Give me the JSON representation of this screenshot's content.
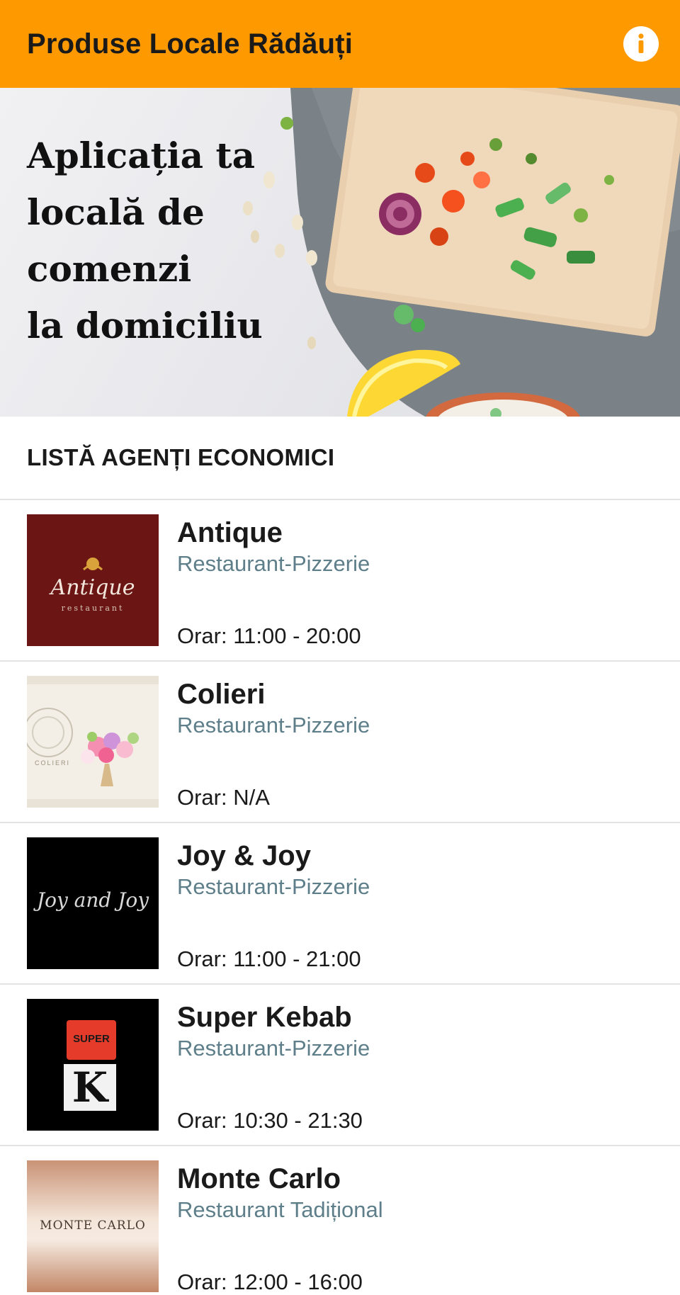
{
  "appbar": {
    "title": "Produse Locale Rădăuți",
    "info_icon": "info-icon",
    "background_color": "#ff9900"
  },
  "hero": {
    "lines": [
      "Aplicația ta",
      "locală de",
      "comenzi",
      "la domiciliu"
    ]
  },
  "section": {
    "title": "LISTĂ AGENȚI ECONOMICI"
  },
  "businesses": [
    {
      "name": "Antique",
      "category": "Restaurant-Pizzerie",
      "hours": "Orar: 11:00 - 20:00",
      "logo_text": "Antique",
      "logo_subtext": "restaurant"
    },
    {
      "name": "Colieri",
      "category": "Restaurant-Pizzerie",
      "hours": "Orar: N/A",
      "logo_text": "COLIERI"
    },
    {
      "name": "Joy & Joy",
      "category": "Restaurant-Pizzerie",
      "hours": "Orar: 11:00 - 21:00",
      "logo_text": "Joy and Joy"
    },
    {
      "name": "Super Kebab",
      "category": "Restaurant-Pizzerie",
      "hours": "Orar: 10:30 - 21:30",
      "logo_text": "SUPER",
      "logo_subtext": "K"
    },
    {
      "name": "Monte Carlo",
      "category": "Restaurant Tadițional",
      "hours": "Orar: 12:00 - 16:00",
      "logo_text": "MONTE CARLO"
    }
  ],
  "colors": {
    "accent": "#ff9900",
    "category_text": "#5e7f8a",
    "divider": "#e3e3e3"
  }
}
